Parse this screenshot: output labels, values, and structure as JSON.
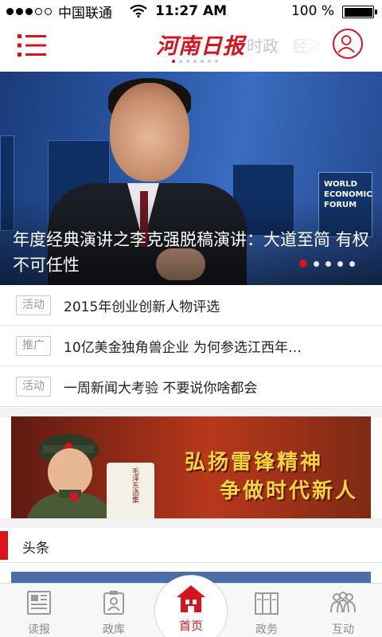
{
  "status_bar": {
    "carrier": "中国联通",
    "time": "11:27 AM",
    "battery": "100 %"
  },
  "top_nav": {
    "logo": "河南日报",
    "channels": [
      "时政",
      "经济"
    ]
  },
  "hero": {
    "title": "年度经典演讲之李克强脱稿演讲：大道至简 有权不可任性",
    "wef_text": "WORLD ECONOMIC FORUM"
  },
  "news_list": [
    {
      "badge": "活动",
      "title": "2015年创业创新人物评选"
    },
    {
      "badge": "推广",
      "title": "10亿美金独角兽企业 为何参选江西年…"
    },
    {
      "badge": "活动",
      "title": "一周新闻大考验  不要说你啥都会"
    }
  ],
  "banner": {
    "line1": "弘扬雷锋精神",
    "line2": "争做时代新人",
    "book_text": "毛泽东选集"
  },
  "section": {
    "title": "头条"
  },
  "tab_bar": {
    "tabs": [
      {
        "label": "读报",
        "icon": "newspaper-icon"
      },
      {
        "label": "政库",
        "icon": "id-badge-icon"
      },
      {
        "label": "首页",
        "icon": "home-icon"
      },
      {
        "label": "政务",
        "icon": "documents-icon"
      },
      {
        "label": "互动",
        "icon": "people-icon"
      }
    ]
  },
  "colors": {
    "accent": "#d7141c",
    "inactive_tab": "#8a8a8a"
  }
}
